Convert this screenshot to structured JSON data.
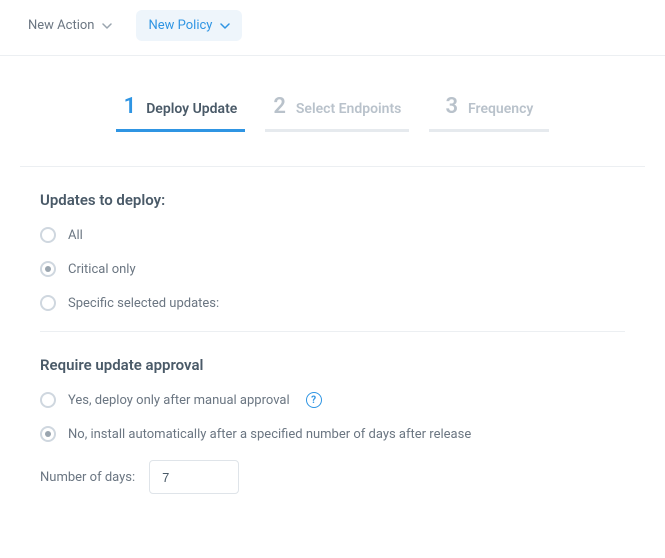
{
  "toolbar": {
    "new_action_label": "New Action",
    "new_policy_label": "New Policy"
  },
  "steps": [
    {
      "num": "1",
      "label": "Deploy Update",
      "active": true
    },
    {
      "num": "2",
      "label": "Select Endpoints",
      "active": false
    },
    {
      "num": "3",
      "label": "Frequency",
      "active": false
    }
  ],
  "updates_section": {
    "title": "Updates to deploy:",
    "options": {
      "all": "All",
      "critical": "Critical only",
      "specific": "Specific selected updates:"
    },
    "selected": "critical"
  },
  "approval_section": {
    "title": "Require update approval",
    "options": {
      "yes": "Yes, deploy only after manual approval",
      "no": "No, install automatically after a specified number of days after release"
    },
    "selected": "no",
    "days_label": "Number of days:",
    "days_value": "7",
    "help_glyph": "?"
  }
}
